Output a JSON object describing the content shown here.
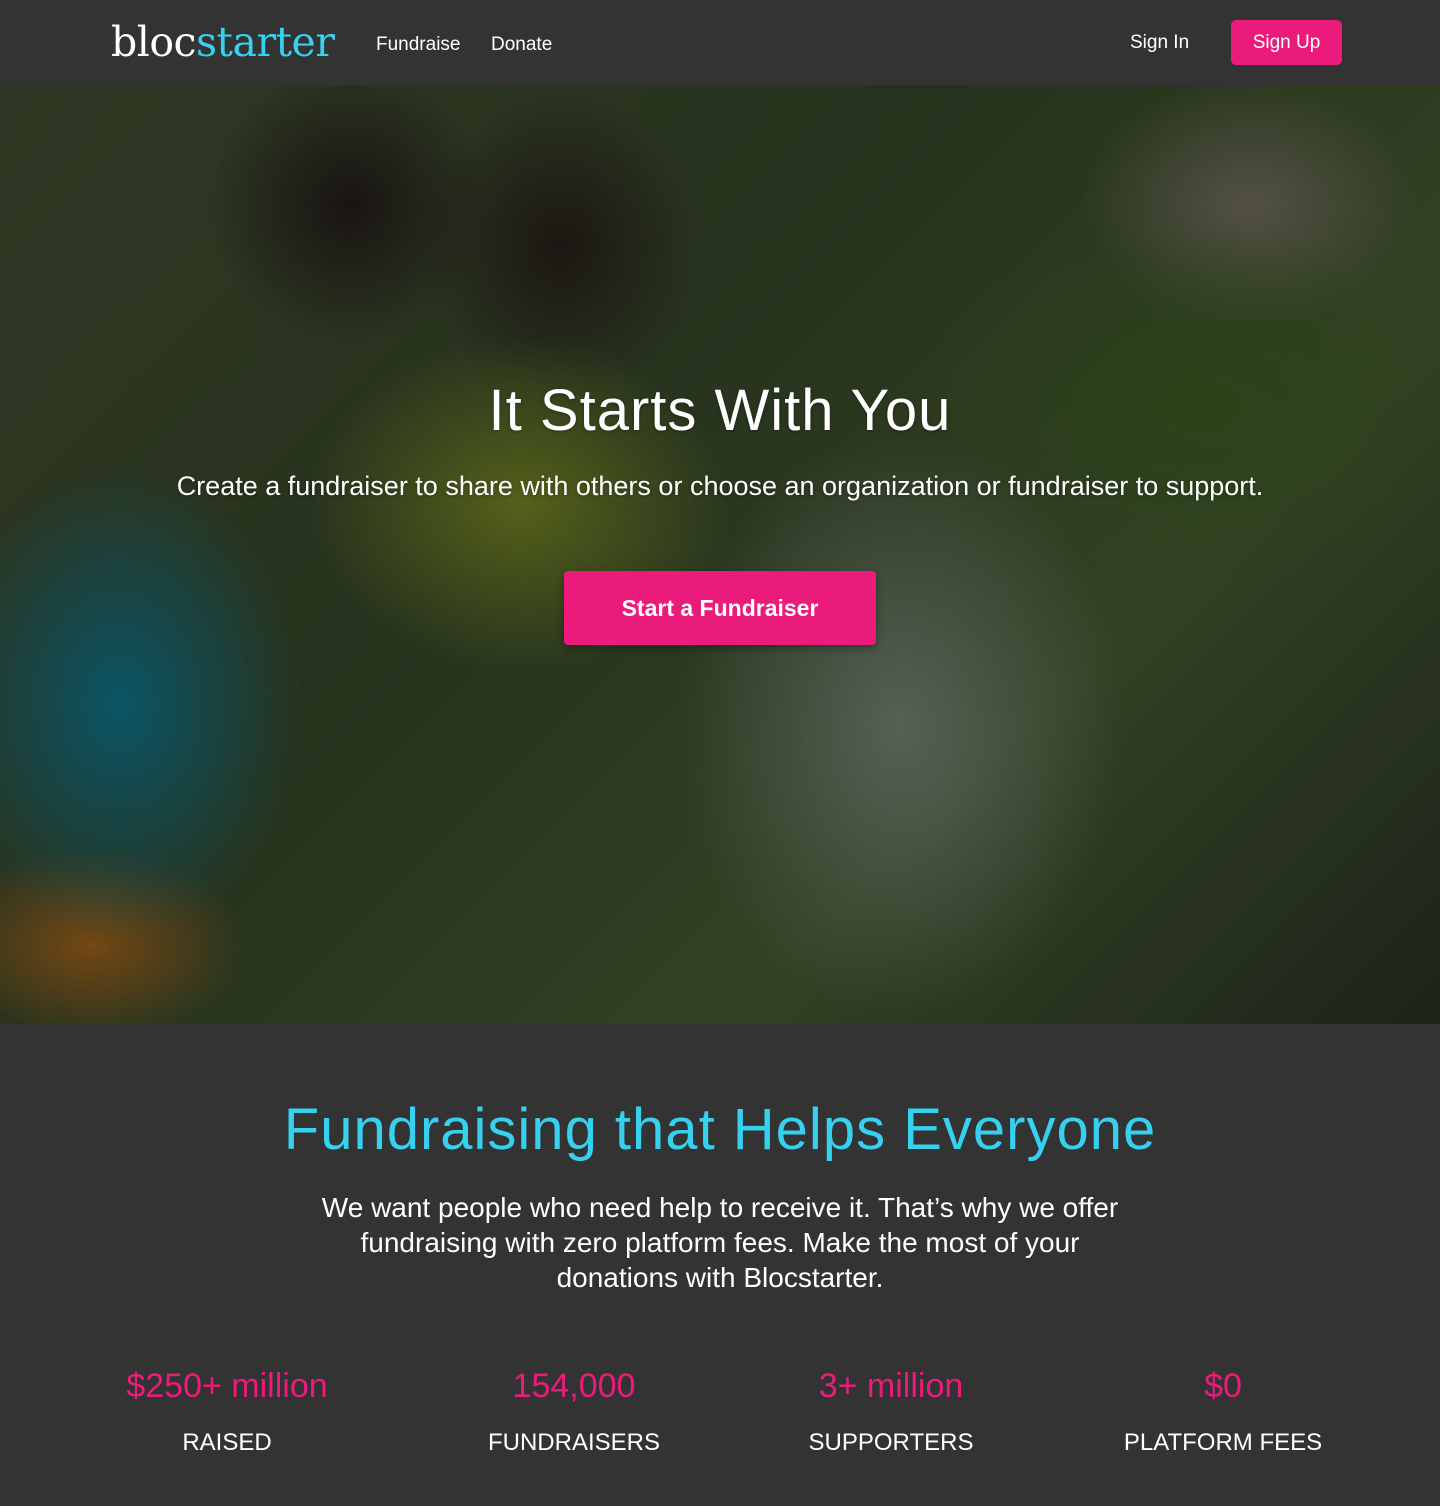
{
  "nav": {
    "logo": {
      "part1": "bloc",
      "part2": "starter"
    },
    "links": {
      "fundraise": "Fundraise",
      "donate": "Donate"
    },
    "sign_in": "Sign In",
    "sign_up": "Sign Up"
  },
  "hero": {
    "title": "It Starts With You",
    "subtitle": "Create a fundraiser to share with others or choose an organization or fundraiser to support.",
    "cta": "Start a Fundraiser"
  },
  "features": {
    "title": "Fundraising that Helps Everyone",
    "body": "We want people who need help to receive it. That’s why we offer fundraising with zero platform fees. Make the most of your donations with Blocstarter.",
    "stats": [
      {
        "value": "$250+ million",
        "label": "RAISED"
      },
      {
        "value": "154,000",
        "label": "FUNDRAISERS"
      },
      {
        "value": "3+ million",
        "label": "SUPPORTERS"
      },
      {
        "value": "$0",
        "label": "PLATFORM FEES"
      }
    ]
  },
  "colors": {
    "background": "#333333",
    "accent_pink": "#ea1b7a",
    "accent_cyan": "#35d1ef"
  }
}
